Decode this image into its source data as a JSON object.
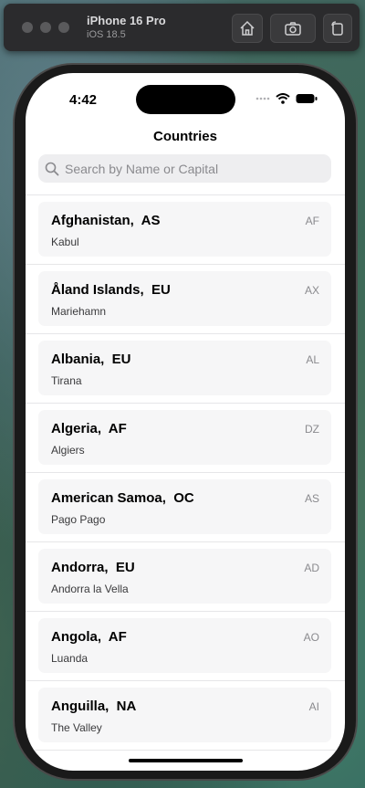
{
  "simulator": {
    "device_name": "iPhone 16 Pro",
    "os_version": "iOS 18.5",
    "buttons": [
      "home-icon",
      "camera-icon",
      "rotate-icon"
    ]
  },
  "status_bar": {
    "time": "4:42",
    "icons": [
      "cellular-icon",
      "wifi-icon",
      "battery-icon"
    ]
  },
  "nav": {
    "title": "Countries"
  },
  "search": {
    "placeholder": "Search by Name or Capital",
    "value": ""
  },
  "countries": [
    {
      "title": "Afghanistan,  AS",
      "capital": "Kabul",
      "code": "AF"
    },
    {
      "title": "Åland Islands,  EU",
      "capital": "Mariehamn",
      "code": "AX"
    },
    {
      "title": "Albania,  EU",
      "capital": "Tirana",
      "code": "AL"
    },
    {
      "title": "Algeria,  AF",
      "capital": "Algiers",
      "code": "DZ"
    },
    {
      "title": "American Samoa,  OC",
      "capital": "Pago Pago",
      "code": "AS"
    },
    {
      "title": "Andorra,  EU",
      "capital": "Andorra la Vella",
      "code": "AD"
    },
    {
      "title": "Angola,  AF",
      "capital": "Luanda",
      "code": "AO"
    },
    {
      "title": "Anguilla,  NA",
      "capital": "The Valley",
      "code": "AI"
    }
  ]
}
